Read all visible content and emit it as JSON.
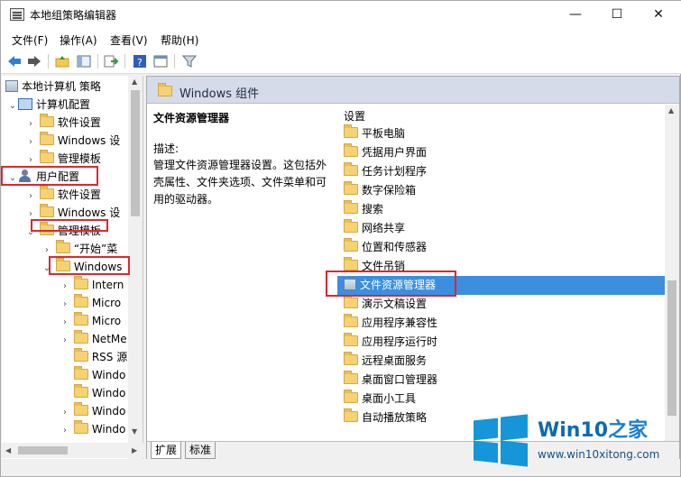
{
  "window": {
    "title": "本地组策略编辑器"
  },
  "controls": {
    "minimize": "—",
    "maximize": "☐",
    "close": "✕"
  },
  "menu": [
    "文件(F)",
    "操作(A)",
    "查看(V)",
    "帮助(H)"
  ],
  "tree": {
    "root": "本地计算机 策略",
    "computer": "计算机配置",
    "computer_children": [
      "软件设置",
      "Windows 设",
      "管理模板"
    ],
    "user": "用户配置",
    "user_children": [
      "软件设置",
      "Windows 设",
      "管理模板"
    ],
    "admin_children": [
      "“开始”菜",
      "Windows"
    ],
    "windows_children": [
      "Intern",
      "Micro",
      "Micro",
      "NetMe",
      "RSS 源",
      "Windo",
      "Windo",
      "Windo",
      "Windo"
    ]
  },
  "header": {
    "title": "Windows 组件"
  },
  "description": {
    "heading": "文件资源管理器",
    "label": "描述:",
    "text": "管理文件资源管理器设置。这包括外壳属性、文件夹选项、文件菜单和可用的驱动器。"
  },
  "list": {
    "column": "设置",
    "items": [
      "平板电脑",
      "凭据用户界面",
      "任务计划程序",
      "数字保险箱",
      "搜索",
      "网络共享",
      "位置和传感器",
      "文件吊销",
      "文件资源管理器",
      "演示文稿设置",
      "应用程序兼容性",
      "应用程序运行时",
      "远程桌面服务",
      "桌面窗口管理器",
      "桌面小工具",
      "自动播放策略"
    ],
    "selected": "文件资源管理器"
  },
  "tabs": [
    "扩展",
    "标准"
  ],
  "watermark": {
    "brand_a": "Win10",
    "brand_b": "之家",
    "url": "www.win10xitong.com"
  },
  "colors": {
    "selection": "#3b8fde",
    "highlight_box": "#e0262e",
    "header_bg": "#d6dbe9"
  }
}
